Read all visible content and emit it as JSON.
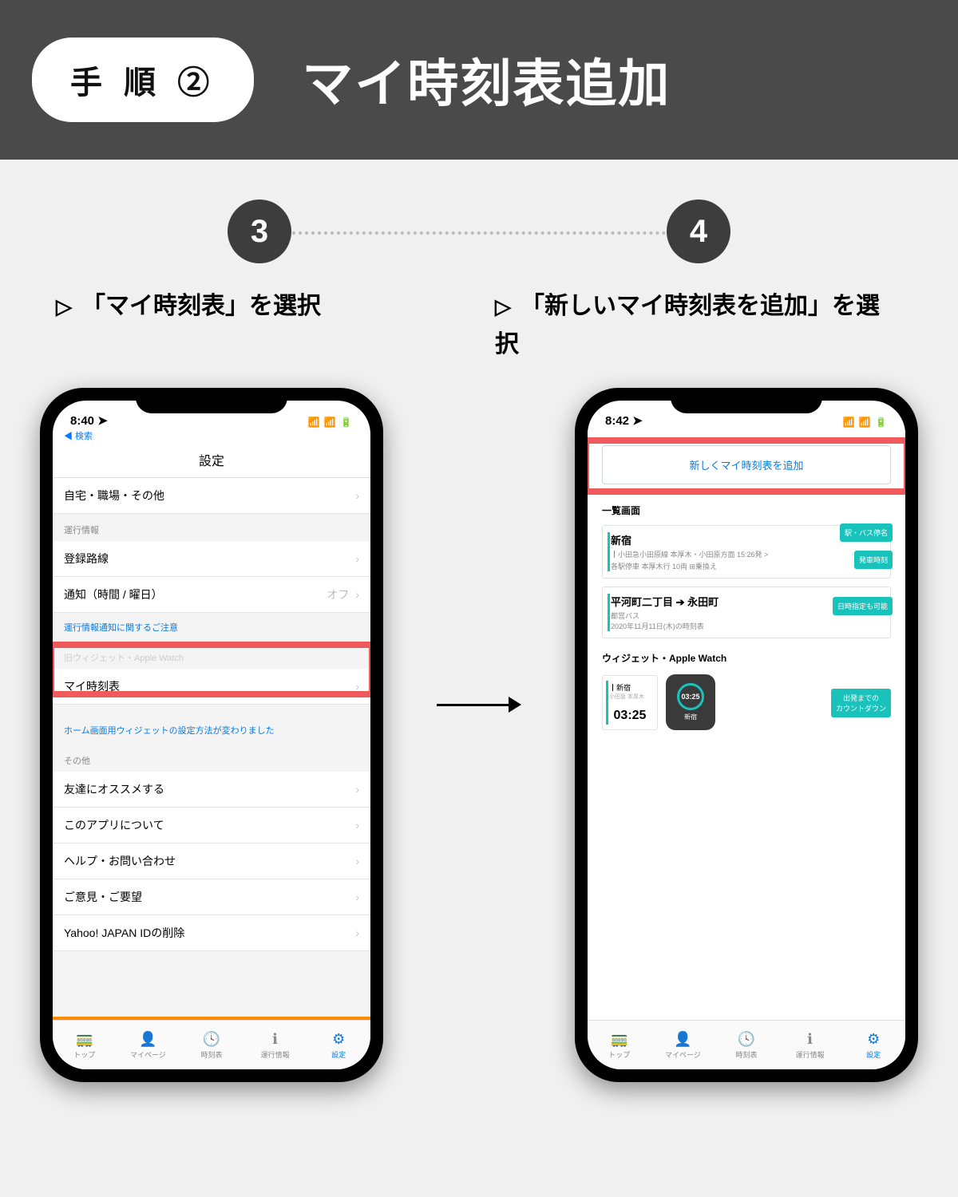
{
  "header": {
    "step_badge": "手 順 ②",
    "title": "マイ時刻表追加"
  },
  "steps": {
    "num3": "3",
    "num4": "4",
    "caption3": "「マイ時刻表」を選択",
    "caption4": "「新しいマイ時刻表を追加」を選択"
  },
  "phone1": {
    "time": "8:40",
    "back": "◀ 検索",
    "title": "設定",
    "rows": {
      "home": "自宅・職場・その他",
      "sec_unko": "運行情報",
      "lines": "登録路線",
      "notify": "通知（時間 / 曜日）",
      "notify_val": "オフ",
      "notice_link": "運行情報通知に関するご注意",
      "sec_widget": "旧ウィジェット・Apple Watch",
      "mytt": "マイ時刻表",
      "widget_note": "ホーム画面用ウィジェットの設定方法が変わりました",
      "sec_other": "その他",
      "recommend": "友達にオススメする",
      "about": "このアプリについて",
      "help": "ヘルプ・お問い合わせ",
      "feedback": "ご意見・ご要望",
      "yid": "Yahoo! JAPAN IDの削除"
    },
    "tabs": [
      "トップ",
      "マイページ",
      "時刻表",
      "運行情報",
      "設定"
    ]
  },
  "phone2": {
    "time": "8:42",
    "add_btn": "新しくマイ時刻表を追加",
    "sec_ichiran": "一覧画面",
    "card1": {
      "title": "新宿",
      "sub1": "┃小田急小田原線 本厚木・小田原方面  15:26発 >",
      "sub2": "各駅停車 本厚木行 10両 ⊞乗換え"
    },
    "card2": {
      "title": "平河町二丁目 ➔ 永田町",
      "sub": "都営バス\n2020年11月11日(木)の時刻表"
    },
    "pills": {
      "p1": "駅・バス停名",
      "p2": "発車時刻",
      "p3": "日時指定も可能",
      "p4": "出発までの\nカウントダウン"
    },
    "sec_widget": "ウィジェット・Apple Watch",
    "widget": {
      "label": "┃新宿",
      "sub": "小田急 本厚木",
      "time": "03:25"
    },
    "watch": {
      "time": "03:25",
      "label": "新宿"
    },
    "tabs": [
      "トップ",
      "マイページ",
      "時刻表",
      "運行情報",
      "設定"
    ]
  }
}
